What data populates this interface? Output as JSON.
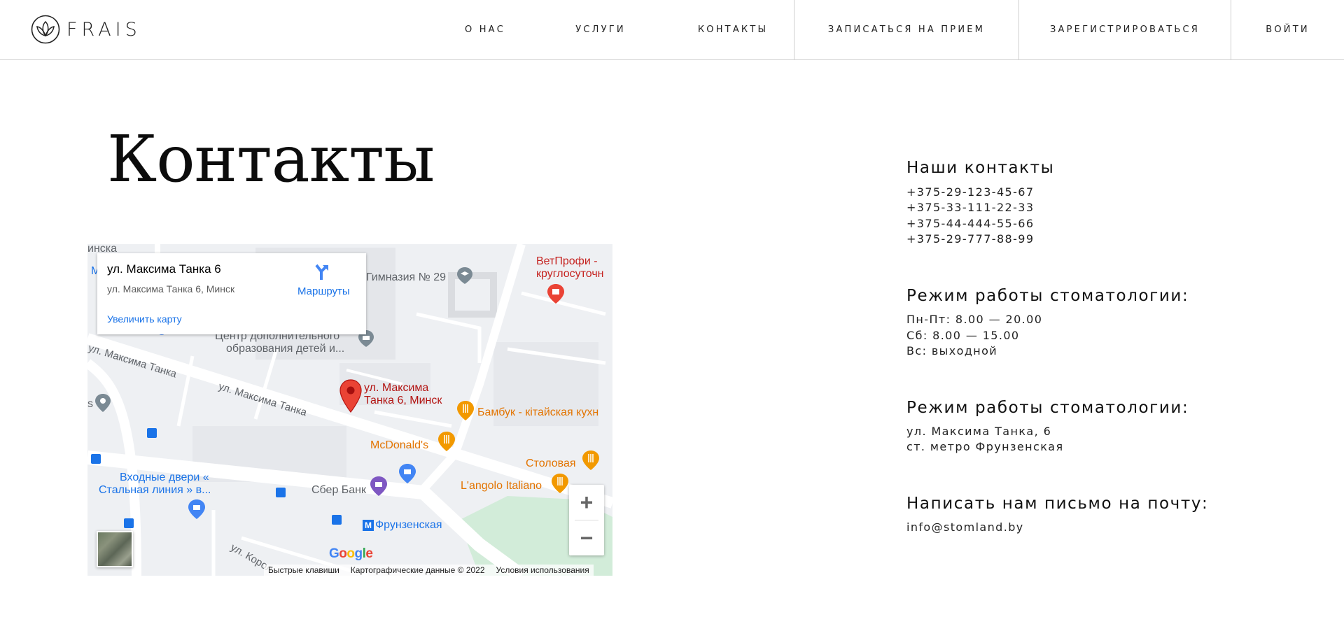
{
  "header": {
    "logo_text": "FRAIS",
    "nav": [
      {
        "label": "О НАС"
      },
      {
        "label": "УСЛУГИ"
      },
      {
        "label": "КОНТАКТЫ"
      },
      {
        "label": "ЗАПИСАТЬСЯ НА ПРИЕМ"
      },
      {
        "label": "ЗАРЕГИСТРИРОВАТЬСЯ"
      },
      {
        "label": "ВОЙТИ"
      }
    ]
  },
  "page": {
    "title": "Контакты"
  },
  "map": {
    "card_title": "ул. Максима Танка 6",
    "card_subtitle": "ул. Максима Танка 6, Минск",
    "card_enlarge": "Увеличить карту",
    "card_routes": "Маршруты",
    "marker_label_1": "ул. Максима",
    "marker_label_2": "Танка 6, Минск",
    "labels": {
      "city_edge": "инска",
      "gymnasium": "Гимназия № 29",
      "vet_1": "ВетПрофи -",
      "vet_2": "круглосуточн",
      "center_1": "Центр дополнительного",
      "center_2": "образования детей и...",
      "road_1": "ул. Максима Танка",
      "road_2": "ул. Максима Танка",
      "road_3": "ул. Корол",
      "bambuk": "Бамбук - кітайская кухн",
      "mcdonalds": "McDonald's",
      "stolovaya": "Столовая",
      "langolo": "L'angolo Italiano",
      "doors_1": "Входные двери «",
      "doors_2": "Стальная линия » в...",
      "sber": "Сбер Банк",
      "metro": "Фрунзенская",
      "edge_s": "s",
      "edge_m": "М"
    },
    "zoom_in": "+",
    "zoom_out": "−",
    "google": "Google",
    "attribution": {
      "shortcuts": "Быстрые клавиши",
      "data": "Картографические данные © 2022",
      "terms": "Условия использования"
    }
  },
  "contacts": {
    "phones_title": "Наши контакты",
    "phones": [
      "+375-29-123-45-67",
      "+375-33-111-22-33",
      "+375-44-444-55-66",
      "+375-29-777-88-99"
    ],
    "hours_title": "Режим работы стоматологии:",
    "hours": [
      "Пн-Пт: 8.00 — 20.00",
      "Сб: 8.00 — 15.00",
      "Вс: выходной"
    ],
    "address_title": "Режим работы стоматологии:",
    "address": [
      "ул. Максима Танка, 6",
      "ст. метро Фрунзенская"
    ],
    "email_title": "Написать нам письмо на почту:",
    "email": "info@stomland.by"
  }
}
